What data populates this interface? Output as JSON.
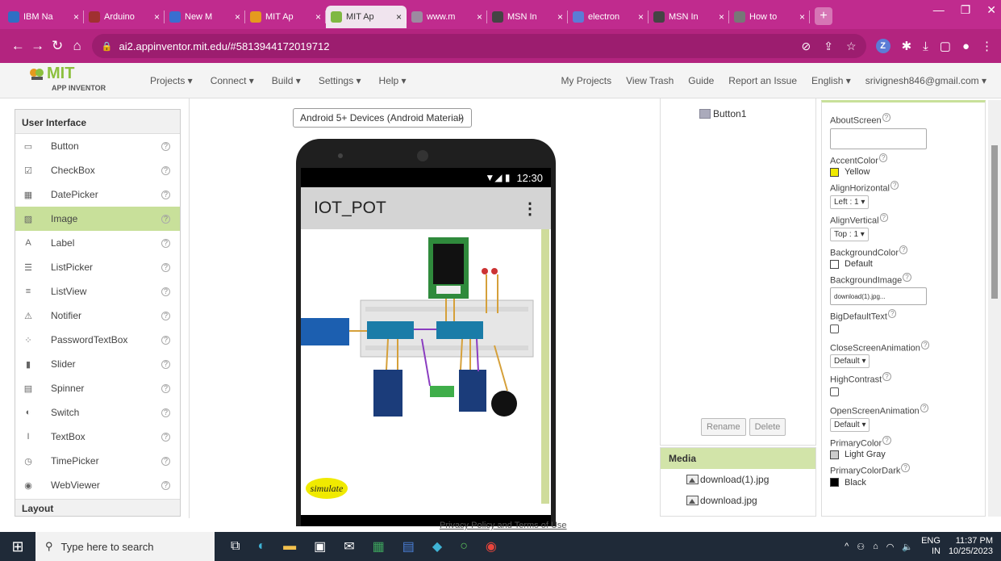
{
  "browser": {
    "tabs": [
      {
        "title": "IBM Na",
        "fav_color": "#2f6fc4",
        "active": false
      },
      {
        "title": "Arduino",
        "fav_color": "#a03030",
        "active": false
      },
      {
        "title": "New M",
        "fav_color": "#3a6ed0",
        "active": false
      },
      {
        "title": "MIT Ap",
        "fav_color": "#e59a1e",
        "active": false
      },
      {
        "title": "MIT Ap",
        "fav_color": "#7fb842",
        "active": true
      },
      {
        "title": "www.m",
        "fav_color": "#9c8aa0",
        "active": false
      },
      {
        "title": "MSN In",
        "fav_color": "#444",
        "active": false
      },
      {
        "title": "electron",
        "fav_color": "#5b7cd6",
        "active": false
      },
      {
        "title": "MSN In",
        "fav_color": "#444",
        "active": false
      },
      {
        "title": "How to",
        "fav_color": "#777",
        "active": false
      }
    ],
    "url": "ai2.appinventor.mit.edu/#5813944172019712",
    "profile_badge": "Z"
  },
  "app_header": {
    "logo_text": "MIT",
    "logo_sub": "APP INVENTOR",
    "menu": [
      "Projects ▾",
      "Connect ▾",
      "Build ▾",
      "Settings ▾",
      "Help ▾"
    ],
    "right_links": [
      "My Projects",
      "View Trash",
      "Guide",
      "Report an Issue",
      "English ▾",
      "srivignesh846@gmail.com ▾"
    ]
  },
  "palette": {
    "section": "User Interface",
    "items": [
      {
        "label": "Button",
        "icon": "button-icon",
        "selected": false
      },
      {
        "label": "CheckBox",
        "icon": "checkbox-icon",
        "selected": false
      },
      {
        "label": "DatePicker",
        "icon": "datepicker-icon",
        "selected": false
      },
      {
        "label": "Image",
        "icon": "image-icon",
        "selected": true
      },
      {
        "label": "Label",
        "icon": "label-icon",
        "selected": false
      },
      {
        "label": "ListPicker",
        "icon": "listpicker-icon",
        "selected": false
      },
      {
        "label": "ListView",
        "icon": "listview-icon",
        "selected": false
      },
      {
        "label": "Notifier",
        "icon": "notifier-icon",
        "selected": false
      },
      {
        "label": "PasswordTextBox",
        "icon": "passwordtextbox-icon",
        "selected": false
      },
      {
        "label": "Slider",
        "icon": "slider-icon",
        "selected": false
      },
      {
        "label": "Spinner",
        "icon": "spinner-icon",
        "selected": false
      },
      {
        "label": "Switch",
        "icon": "switch-icon",
        "selected": false
      },
      {
        "label": "TextBox",
        "icon": "textbox-icon",
        "selected": false
      },
      {
        "label": "TimePicker",
        "icon": "timepicker-icon",
        "selected": false
      },
      {
        "label": "WebViewer",
        "icon": "webviewer-icon",
        "selected": false
      }
    ],
    "next_section": "Layout"
  },
  "viewer": {
    "device_select": "Android 5+ Devices (Android Material)",
    "status_time": "12:30",
    "app_title": "IOT_POT",
    "simulate_label": "simulate"
  },
  "components": {
    "items": [
      "Button1"
    ],
    "rename_label": "Rename",
    "delete_label": "Delete"
  },
  "media": {
    "title": "Media",
    "files": [
      "download(1).jpg",
      "download.jpg"
    ]
  },
  "properties": {
    "about_screen_label": "AboutScreen",
    "accent_color_label": "AccentColor",
    "accent_color_value": "Yellow",
    "align_h_label": "AlignHorizontal",
    "align_h_value": "Left : 1 ▾",
    "align_v_label": "AlignVertical",
    "align_v_value": "Top : 1 ▾",
    "bg_color_label": "BackgroundColor",
    "bg_color_value": "Default",
    "bg_image_label": "BackgroundImage",
    "bg_image_value": "download(1).jpg...",
    "big_text_label": "BigDefaultText",
    "close_anim_label": "CloseScreenAnimation",
    "close_anim_value": "Default ▾",
    "high_contrast_label": "HighContrast",
    "open_anim_label": "OpenScreenAnimation",
    "open_anim_value": "Default ▾",
    "primary_color_label": "PrimaryColor",
    "primary_color_value": "Light Gray",
    "primary_dark_label": "PrimaryColorDark",
    "primary_dark_value": "Black"
  },
  "footer": {
    "privacy": "Privacy Policy and Terms of Use"
  },
  "taskbar": {
    "search_placeholder": "Type here to search",
    "lang": "ENG",
    "region": "IN",
    "time": "11:37 PM",
    "date": "10/25/2023"
  },
  "colors": {
    "tab_bar": "#c02b8e",
    "accent_green": "#c8e09a",
    "accent_yellow": "#f0ea00"
  }
}
